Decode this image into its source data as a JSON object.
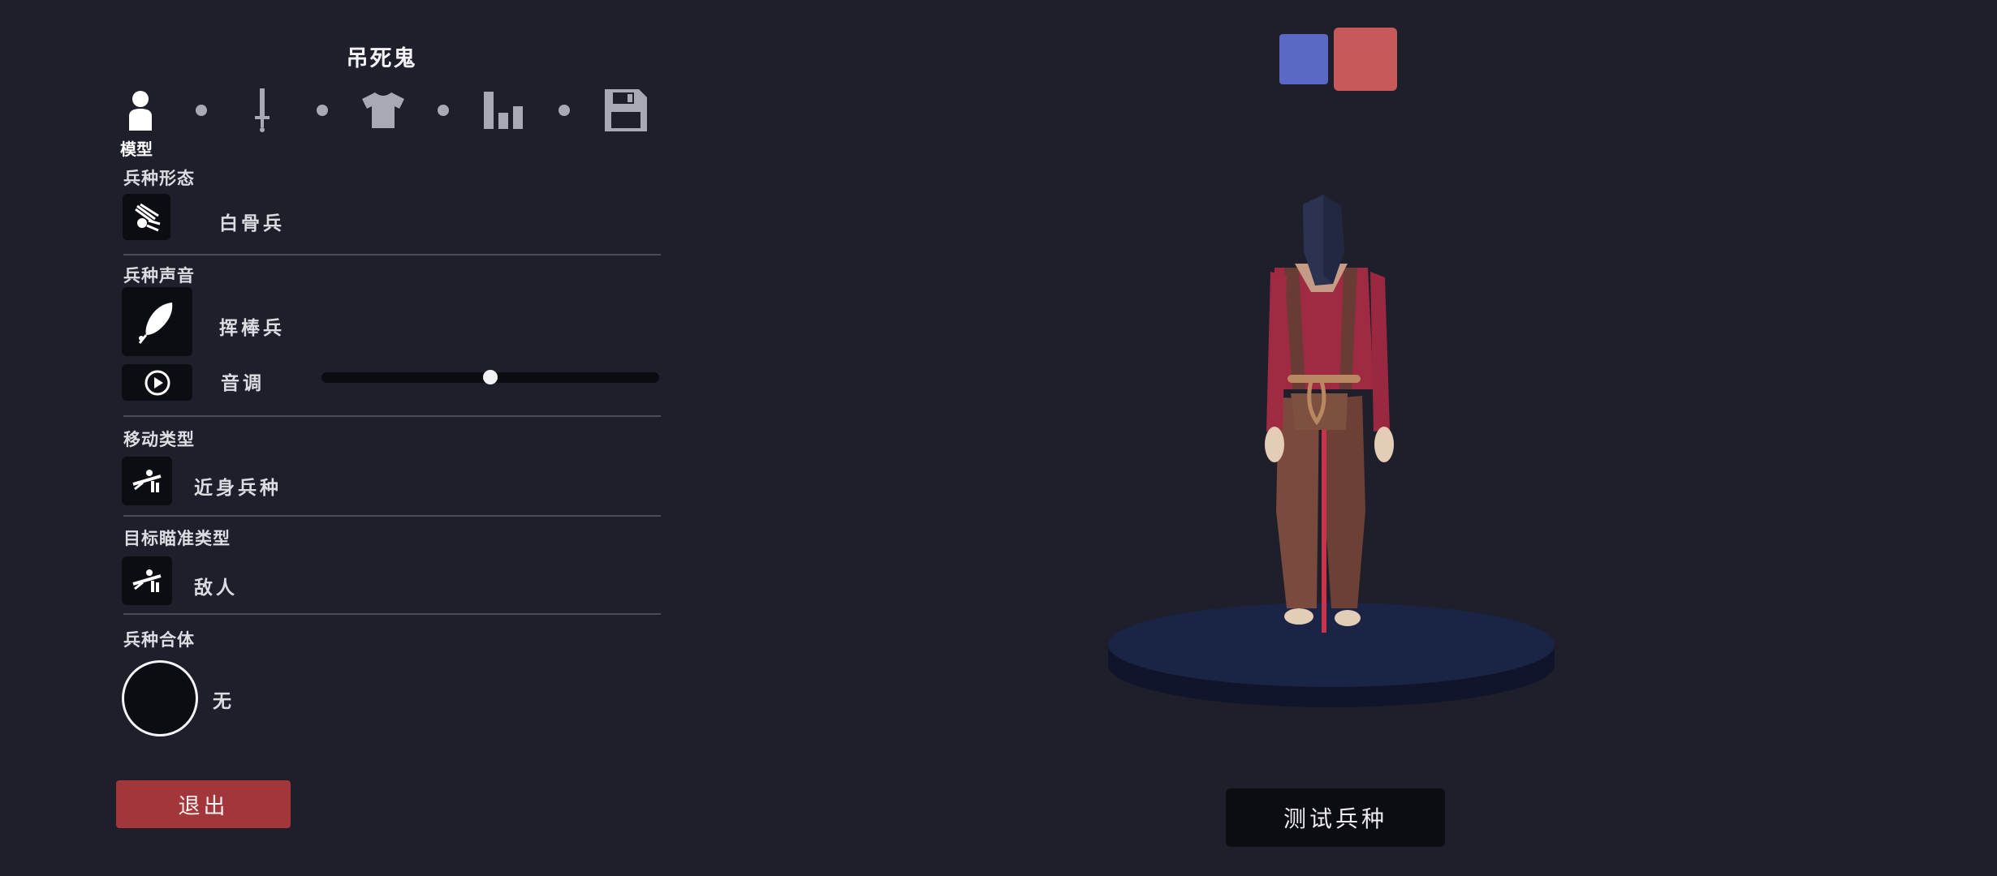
{
  "unit": {
    "name": "吊死鬼"
  },
  "editor_steps": [
    {
      "icon": "person-icon",
      "label": "模型",
      "active": true
    },
    {
      "icon": "sword-icon",
      "active": false
    },
    {
      "icon": "shirt-icon",
      "active": false
    },
    {
      "icon": "stats-icon",
      "active": false
    },
    {
      "icon": "save-icon",
      "active": false
    }
  ],
  "sections": {
    "form": {
      "label": "兵种形态",
      "value": "白骨兵",
      "icon": "skeleton-icon"
    },
    "voice": {
      "label": "兵种声音",
      "value": "挥棒兵",
      "icon": "feather-icon",
      "pitch_label": "音调",
      "pitch_value": 0.5,
      "play_icon": "play-icon"
    },
    "movement": {
      "label": "移动类型",
      "value": "近身兵种",
      "icon": "melee-icon"
    },
    "targeting": {
      "label": "目标瞄准类型",
      "value": "敌人",
      "icon": "target-icon"
    },
    "combo": {
      "label": "兵种合体",
      "value": "无"
    }
  },
  "buttons": {
    "exit": "退出",
    "test": "测试兵种"
  },
  "team_colors": [
    "#5a69c3",
    "#c8595a"
  ]
}
